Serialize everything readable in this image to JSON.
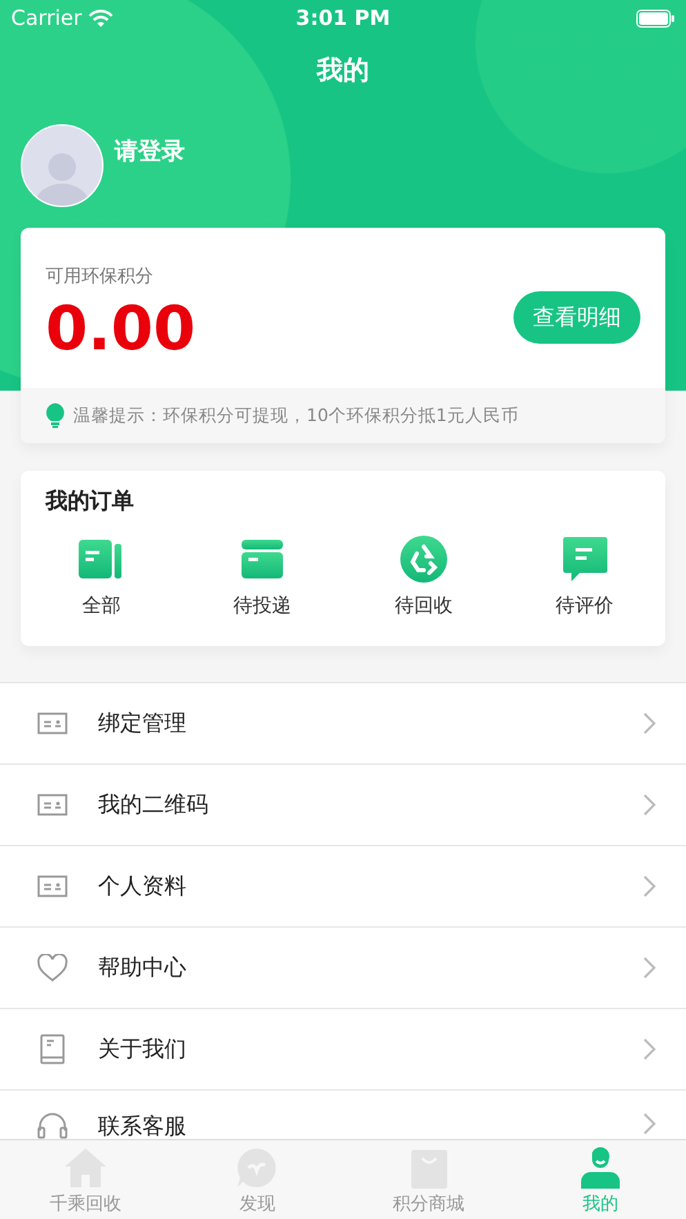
{
  "status_bar": {
    "carrier": "Carrier",
    "time": "3:01 PM"
  },
  "title": "我的",
  "profile": {
    "name": "请登录"
  },
  "points": {
    "label": "可用环保积分",
    "value": "0.00",
    "button": "查看明细",
    "tip": "温馨提示：环保积分可提现，10个环保积分抵1元人民币"
  },
  "orders": {
    "title": "我的订单",
    "items": [
      {
        "kind": "all",
        "label": "全部"
      },
      {
        "kind": "box",
        "label": "待投递"
      },
      {
        "kind": "recycle",
        "label": "待回收"
      },
      {
        "kind": "comment",
        "label": "待评价"
      }
    ]
  },
  "menu": [
    {
      "kind": "card",
      "label": "绑定管理"
    },
    {
      "kind": "card",
      "label": "我的二维码"
    },
    {
      "kind": "card",
      "label": "个人资料"
    },
    {
      "kind": "heart",
      "label": "帮助中心"
    },
    {
      "kind": "book",
      "label": "关于我们"
    },
    {
      "kind": "headset",
      "label": "联系客服"
    }
  ],
  "tab_bar": [
    {
      "kind": "home",
      "label": "千乘回收",
      "selected": false
    },
    {
      "kind": "discover",
      "label": "发现",
      "selected": false
    },
    {
      "kind": "shop",
      "label": "积分商城",
      "selected": false
    },
    {
      "kind": "me",
      "label": "我的",
      "selected": true
    }
  ]
}
